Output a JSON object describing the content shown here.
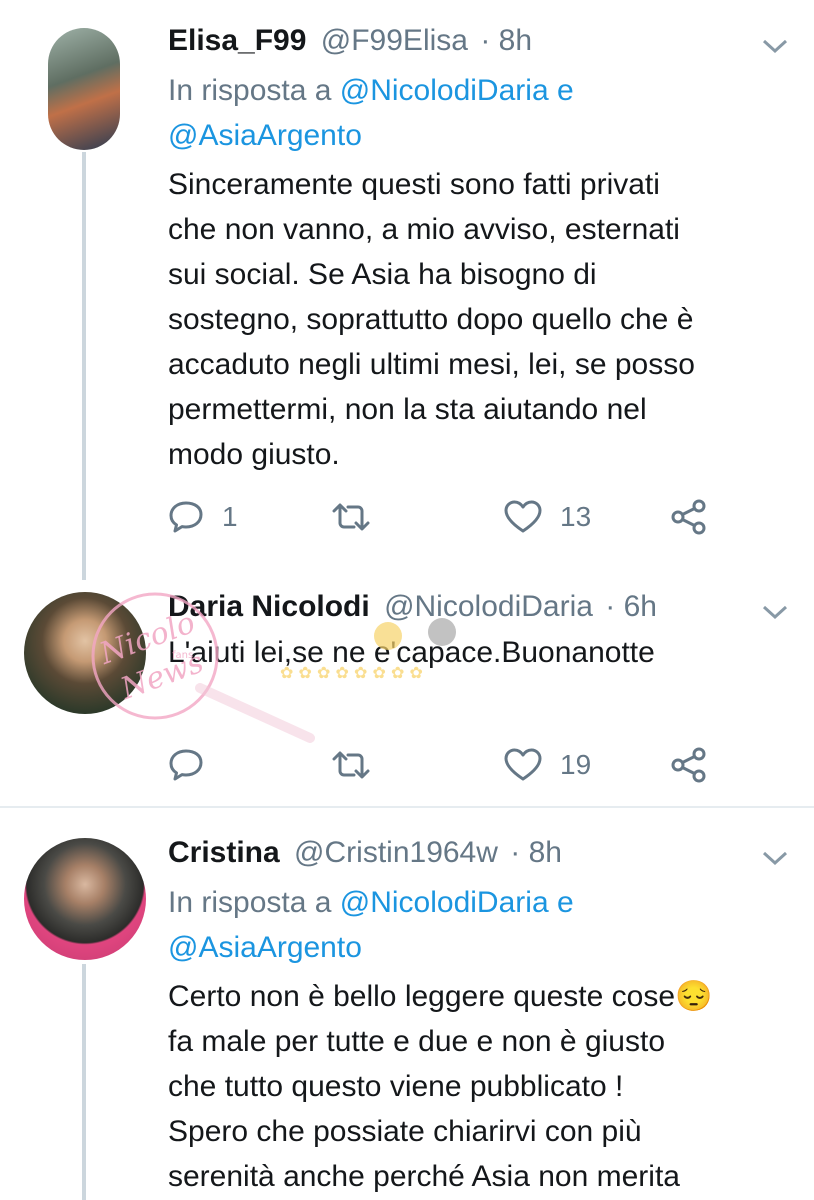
{
  "tweets": [
    {
      "name": "Elisa_F99",
      "handle": "@F99Elisa",
      "time": "· 8h",
      "reply_prefix": "In risposta a",
      "reply_mention_1": "@NicolodiDaria",
      "reply_joiner": "e",
      "reply_mention_2": "@AsiaArgento",
      "lines": [
        "Sinceramente questi sono fatti privati",
        "che non vanno, a mio avviso, esternati",
        "sui social. Se Asia ha bisogno di",
        "sostegno, soprattutto dopo quello che è",
        "accaduto negli ultimi mesi, lei, se posso",
        "permettermi, non la sta aiutando nel",
        "modo giusto."
      ],
      "replies": "1",
      "retweets": "",
      "likes": "13",
      "avatar_colors": [
        "#6b7f6a",
        "#c46a3a"
      ]
    },
    {
      "name": "Daria Nicolodi",
      "handle": "@NicolodiDaria",
      "time": "· 6h",
      "lines": [
        "L'aiuti lei,se ne e'capace.Buonanotte"
      ],
      "replies": "",
      "retweets": "",
      "likes": "19"
    },
    {
      "name": "Cristina",
      "handle": "@Cristin1964w",
      "time": "· 8h",
      "reply_prefix": "In risposta a",
      "reply_mention_1": "@NicolodiDaria",
      "reply_joiner": "e",
      "reply_mention_2": "@AsiaArgento",
      "lines": [
        "Certo non è bello leggere queste cose",
        "fa male per tutte e due e non è giusto",
        "che tutto questo viene pubblicato !",
        "Spero che possiate chiarirvi con più",
        "serenità anche perché Asia non merita"
      ],
      "emoji": "😔"
    }
  ],
  "watermark": {
    "text_1": "Nicolo",
    "text_2": "News",
    "text_small": "fans"
  },
  "colors": {
    "link": "#1b95e0",
    "muted": "#657786",
    "text": "#14171a",
    "line": "#ccd6dd",
    "watermark": "#f2a6c4"
  }
}
